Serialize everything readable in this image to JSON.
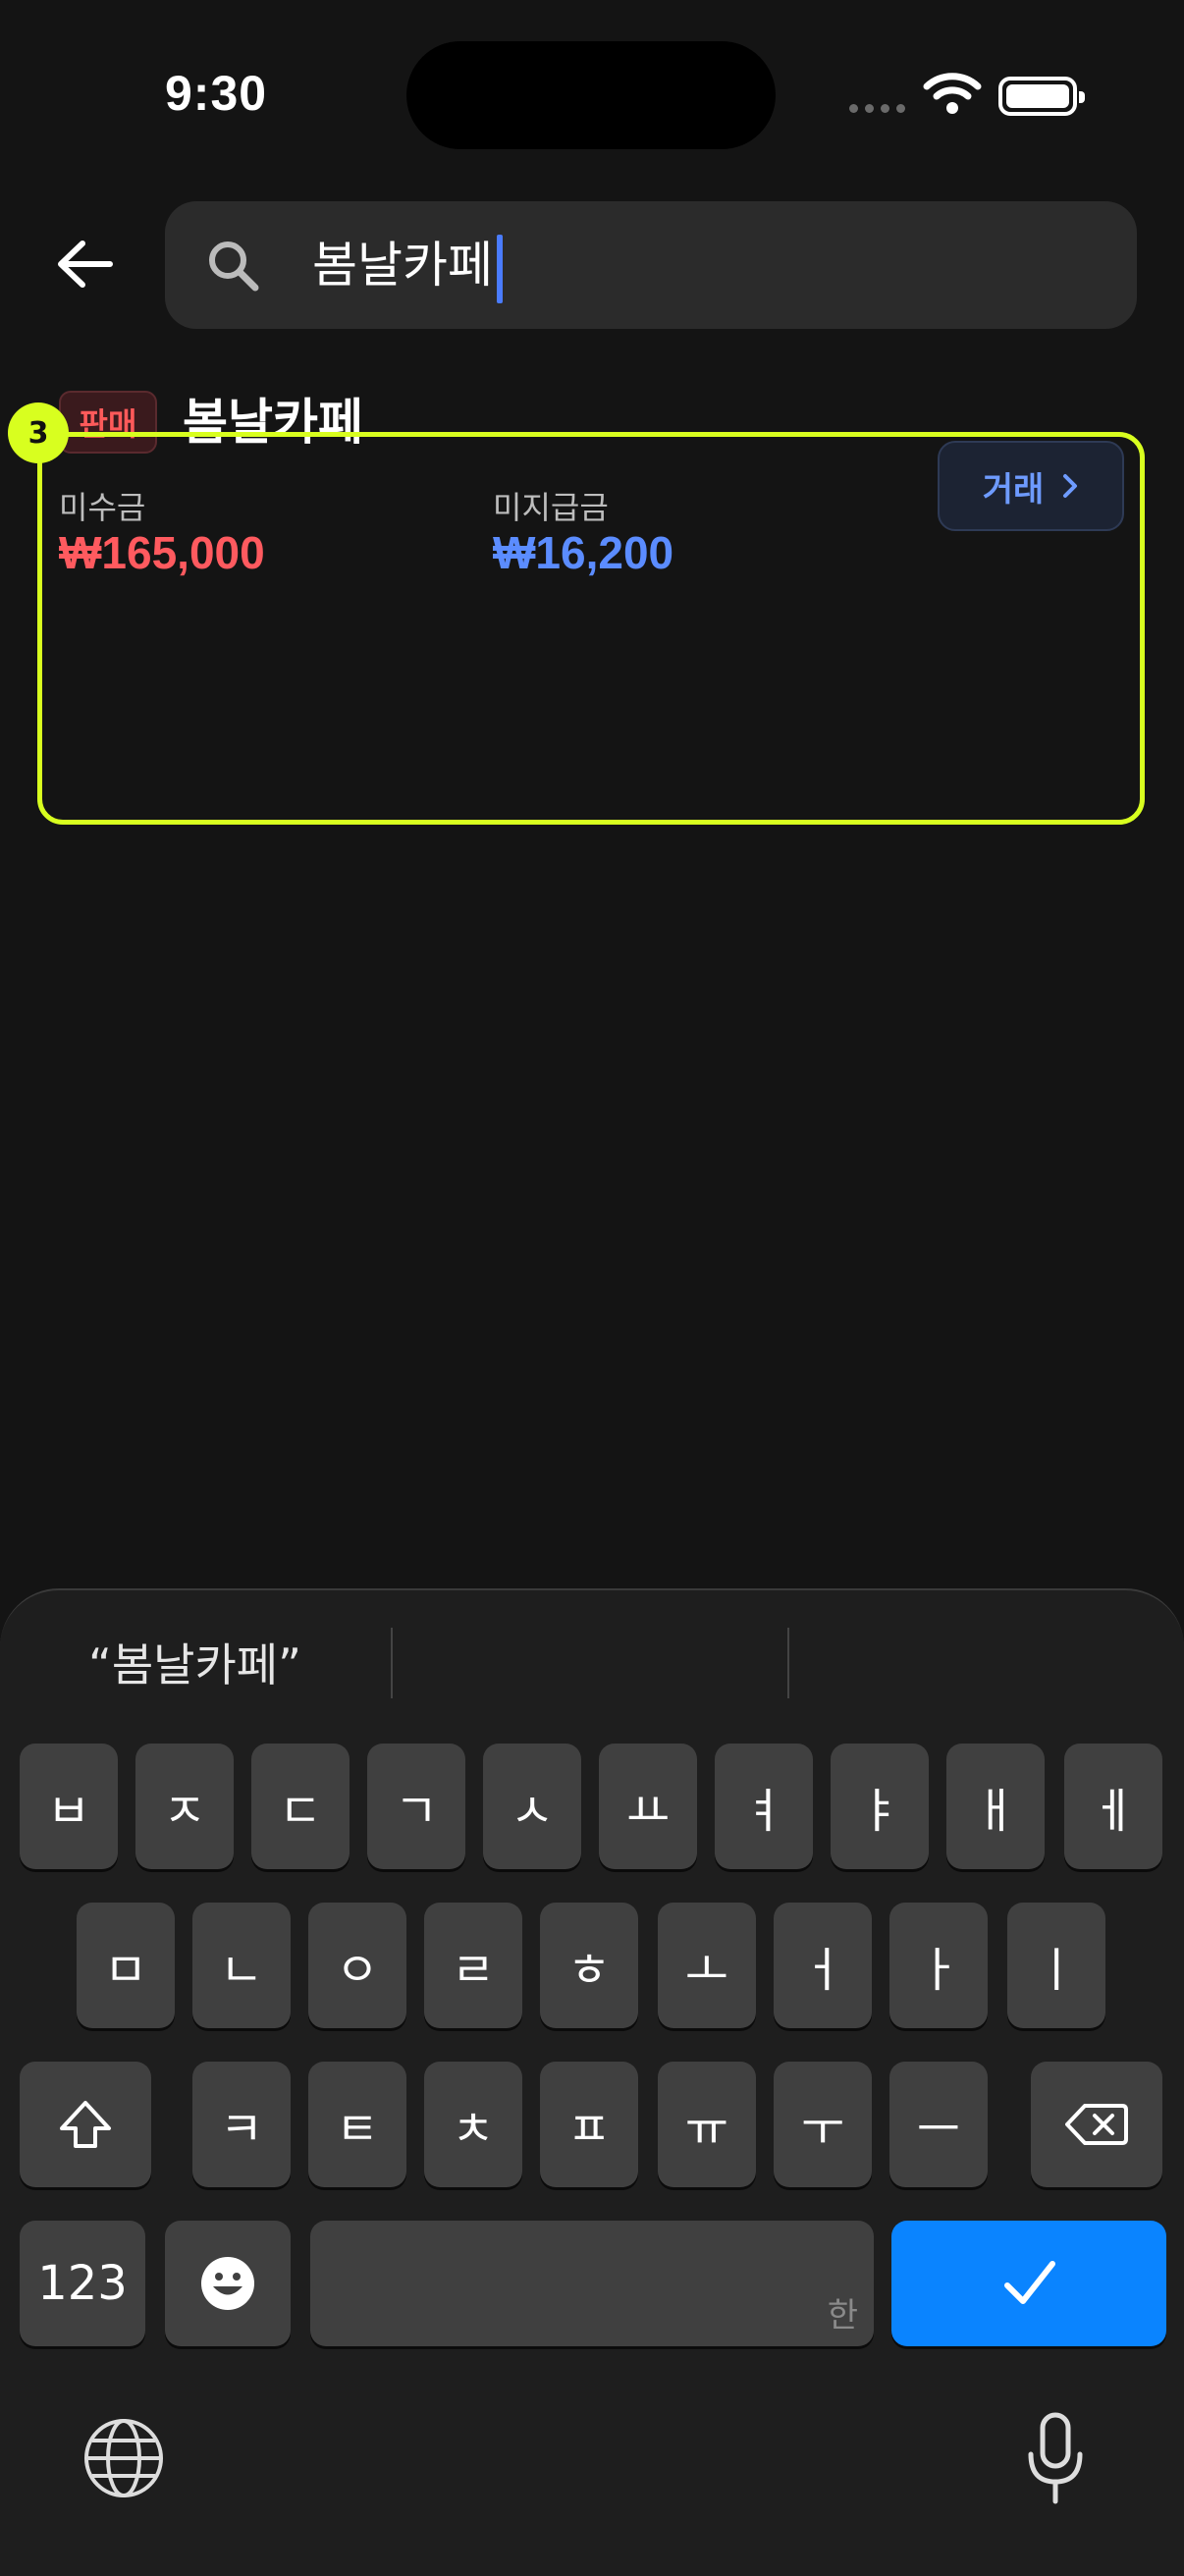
{
  "status": {
    "time": "9:30"
  },
  "search": {
    "query": "봄날카페",
    "icon": "search-icon"
  },
  "result": {
    "badge": "판매",
    "name": "봄날카페",
    "marker": "3",
    "receivable_label": "미수금",
    "receivable_amount": "₩165,000",
    "payable_label": "미지급금",
    "payable_amount": "₩16,200",
    "trade_button": "거래"
  },
  "keyboard": {
    "suggestion": "“봄날카페”",
    "row1": [
      "ㅂ",
      "ㅈ",
      "ㄷ",
      "ㄱ",
      "ㅅ",
      "ㅛ",
      "ㅕ",
      "ㅑ",
      "ㅐ",
      "ㅔ"
    ],
    "row2": [
      "ㅁ",
      "ㄴ",
      "ㅇ",
      "ㄹ",
      "ㅎ",
      "ㅗ",
      "ㅓ",
      "ㅏ",
      "ㅣ"
    ],
    "row3": [
      "ㅋ",
      "ㅌ",
      "ㅊ",
      "ㅍ",
      "ㅠ",
      "ㅜ",
      "ㅡ"
    ],
    "numbers_key": "123",
    "space_hint": "한",
    "colors": {
      "accent": "#0a84ff",
      "highlight": "#d8ff1f",
      "receivable": "#ff5a5f",
      "payable": "#5b8cff"
    }
  }
}
